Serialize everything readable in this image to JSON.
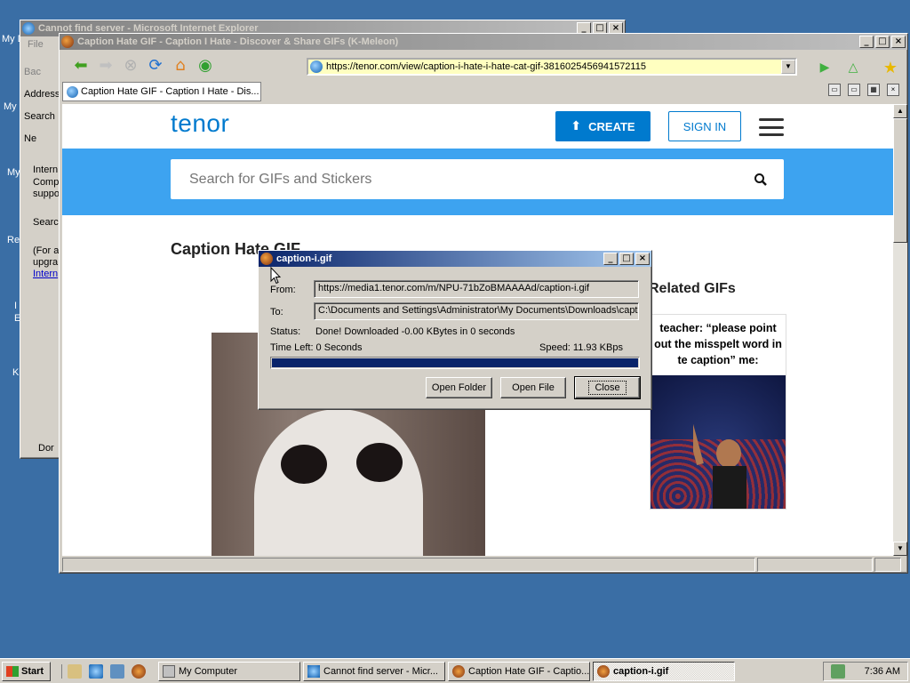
{
  "desktop": {
    "labels": [
      "My D",
      "My",
      "My",
      "Re",
      "I",
      "E",
      "K"
    ]
  },
  "ie_window": {
    "title": "Cannot find server - Microsoft Internet Explorer",
    "menu_file": "File",
    "back": "Bac",
    "address": "Address",
    "search": "Search",
    "new": "Ne",
    "body_lines": [
      "Intern",
      "Comp",
      "suppo",
      "Searc",
      "(For a",
      "upgra",
      "Intern"
    ],
    "status": "Dor"
  },
  "km_window": {
    "title": "Caption Hate GIF - Caption I Hate - Discover & Share GIFs (K-Meleon)",
    "url": "https://tenor.com/view/caption-i-hate-i-hate-cat-gif-3816025456941572115",
    "tab_label": "Caption Hate GIF - Caption I Hate - Dis..."
  },
  "tenor": {
    "logo": "tenor",
    "create_label": "CREATE",
    "signin_label": "SIGN IN",
    "search_placeholder": "Search for GIFs and Stickers",
    "page_title": "Caption Hate GIF",
    "related_title": "Related GIFs",
    "related_caption": "teacher: “please point out the misspelt word in te caption” me:"
  },
  "download_dialog": {
    "title": "caption-i.gif",
    "from_label": "From:",
    "from_value": "https://media1.tenor.com/m/NPU-71bZoBMAAAAd/caption-i.gif",
    "to_label": "To:",
    "to_value": "C:\\Documents and Settings\\Administrator\\My Documents\\Downloads\\capti",
    "status_label": "Status:",
    "status_value": "Done! Downloaded -0.00 KBytes in 0 seconds",
    "time_left": "Time Left: 0 Seconds",
    "speed": "Speed: 11.93 KBps",
    "progress_fraction": 1.0,
    "open_folder_label": "Open Folder",
    "open_file_label": "Open File",
    "close_label": "Close"
  },
  "taskbar": {
    "start_label": "Start",
    "tasks": [
      "My Computer",
      "Cannot find server - Micr...",
      "Caption Hate GIF - Captio...",
      "caption-i.gif"
    ],
    "clock": "7:36 AM"
  },
  "colors": {
    "desktop": "#3a6ea5",
    "tenor_blue": "#007ace",
    "search_band": "#3da3f0",
    "title_active": "#0a246a",
    "url_bg": "#ffffc0"
  }
}
